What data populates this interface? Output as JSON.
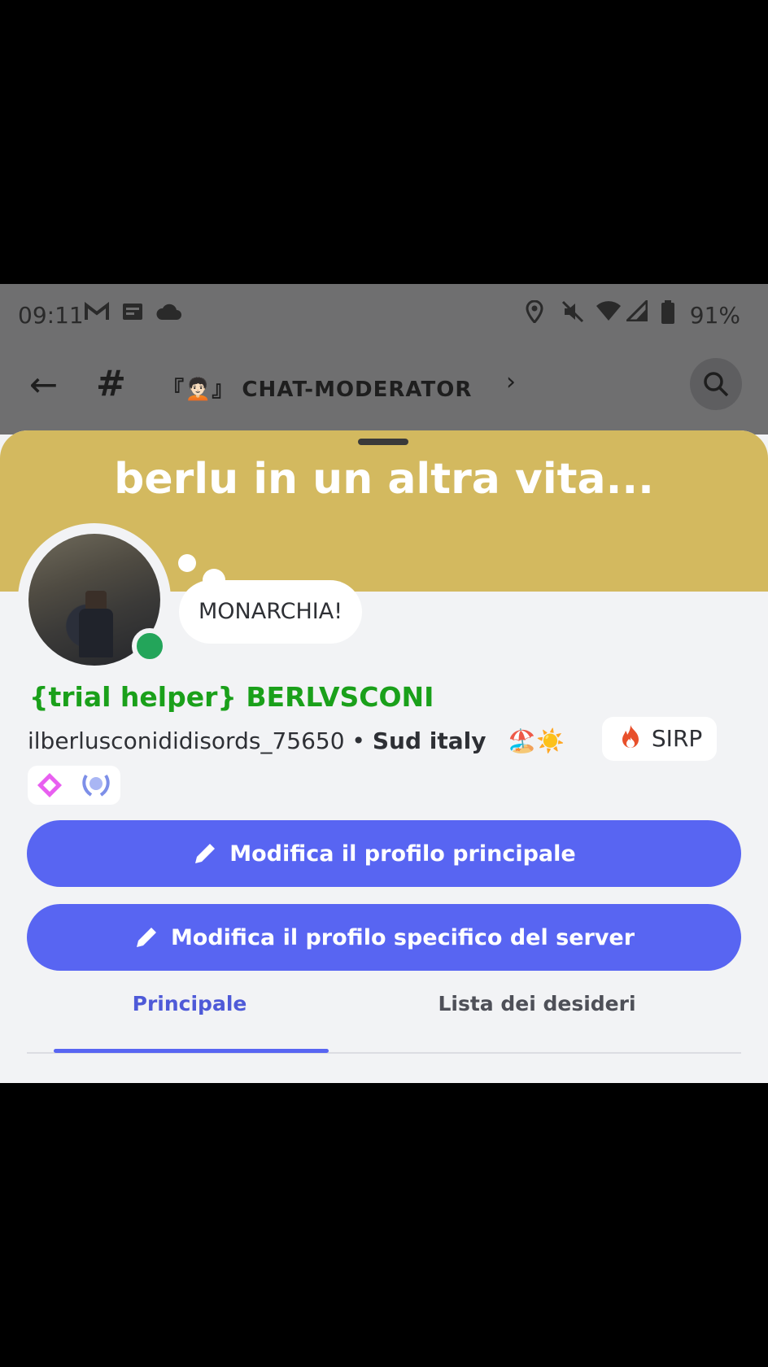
{
  "status_bar": {
    "time": "09:11",
    "battery": "91%"
  },
  "header": {
    "channel_title": "『🧑🏻‍🦱』 CHAT-MODERATOR"
  },
  "profile": {
    "banner_text": "berlu in un altra vita...",
    "banner_color": "#d3b95f",
    "custom_status": "MONARCHIA!",
    "display_name": "{trial helper} BERLVSCONI",
    "username": "ilberlusconididisords_75650",
    "location": "Sud italy",
    "location_emoji": "🏖️☀️",
    "server_tag": "SIRP",
    "online_color": "#23a55a"
  },
  "buttons": {
    "edit_main": "Modifica il profilo principale",
    "edit_server": "Modifica il profilo specifico del server"
  },
  "tabs": [
    "Principale",
    "Lista dei desideri"
  ],
  "colors": {
    "accent": "#5865f2",
    "name": "#1aa01a"
  }
}
